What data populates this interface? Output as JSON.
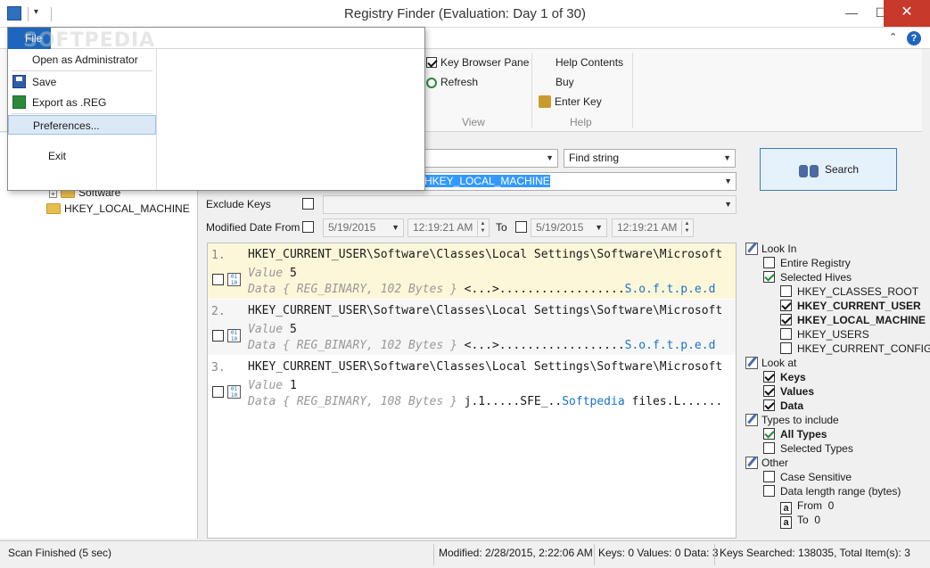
{
  "window": {
    "title": "Registry Finder (Evaluation: Day 1 of 30)",
    "minimize": "—",
    "maximize": "☐",
    "close": "✕"
  },
  "ribbon": {
    "file_tab": "File",
    "view": {
      "key_browser_pane": "Key Browser Pane",
      "key_browser_pane_checked": true,
      "refresh": "Refresh",
      "group_label": "View"
    },
    "help": {
      "help_contents": "Help Contents",
      "buy": "Buy",
      "enter_key": "Enter Key",
      "group_label": "Help"
    }
  },
  "file_menu": {
    "items": [
      {
        "label": "Open as Administrator"
      },
      {
        "label": "Save",
        "icon": "save-icon"
      },
      {
        "label": "Export as .REG",
        "icon": "export-reg-icon"
      },
      {
        "label": "Preferences..."
      },
      {
        "label": "Exit"
      }
    ]
  },
  "tree": {
    "software": "Software",
    "hklm": "HKEY_LOCAL_MACHINE"
  },
  "search": {
    "find_mode": "Find string",
    "location_value": "HKEY_LOCAL_MACHINE",
    "exclude_keys_label": "Exclude Keys",
    "modified_label": "Modified Date From",
    "from_date": "5/19/2015",
    "from_time": "12:19:21 AM",
    "to_label": "To",
    "to_date": "5/19/2015",
    "to_time": "12:19:21 AM",
    "button": "Search"
  },
  "results": [
    {
      "num": "1.",
      "path": "HKEY_CURRENT_USER\\Software\\Classes\\Local Settings\\Software\\Microsoft",
      "value_label": "Value",
      "value": "5",
      "data_label": "Data",
      "data_type": "{ REG_BINARY, 102 Bytes }",
      "data_pre": "<...>..................",
      "data_hl": "S.o.f.t.p.e.d"
    },
    {
      "num": "2.",
      "path": "HKEY_CURRENT_USER\\Software\\Classes\\Local Settings\\Software\\Microsoft",
      "value_label": "Value",
      "value": "5",
      "data_label": "Data",
      "data_type": "{ REG_BINARY, 102 Bytes }",
      "data_pre": "<...>..................",
      "data_hl": "S.o.f.t.p.e.d"
    },
    {
      "num": "3.",
      "path": "HKEY_CURRENT_USER\\Software\\Classes\\Local Settings\\Software\\Microsoft",
      "value_label": "Value",
      "value": "1",
      "data_label": "Data",
      "data_type": "{ REG_BINARY, 108 Bytes }",
      "data_pre": "j.1.....SFE_..",
      "data_hl": "Softpedia",
      "data_post": " files.L......"
    }
  ],
  "options": {
    "look_in": "Look In",
    "entire_registry": "Entire Registry",
    "selected_hives": "Selected Hives",
    "hkcr": "HKEY_CLASSES_ROOT",
    "hkcu": "HKEY_CURRENT_USER",
    "hklm": "HKEY_LOCAL_MACHINE",
    "hku": "HKEY_USERS",
    "hkcc": "HKEY_CURRENT_CONFIG",
    "look_at": "Look at",
    "keys": "Keys",
    "values": "Values",
    "data": "Data",
    "types_to_include": "Types to include",
    "all_types": "All Types",
    "selected_types": "Selected Types",
    "other": "Other",
    "case_sensitive": "Case Sensitive",
    "data_length_range": "Data length range (bytes)",
    "from_label": "From",
    "from_value": "0",
    "to_label": "To",
    "to_value": "0"
  },
  "status": {
    "scan": "Scan Finished (5 sec)",
    "modified": "Modified: 2/28/2015, 2:22:06 AM",
    "counts": "Keys: 0 Values: 0 Data: 3",
    "searched": "Keys Searched: 138035, Total Item(s): 3"
  },
  "watermark": "SOFTPEDIA"
}
